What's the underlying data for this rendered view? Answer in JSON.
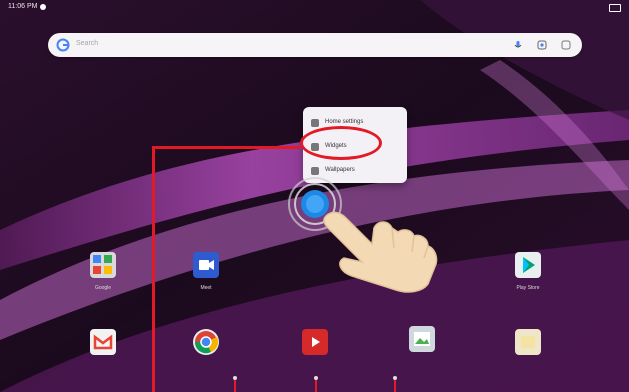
{
  "status_bar": {
    "time": "11:06 PM"
  },
  "search": {
    "placeholder": "Search"
  },
  "context_menu": {
    "items": [
      {
        "label": "Home settings"
      },
      {
        "label": "Widgets"
      },
      {
        "label": "Wallpapers"
      }
    ]
  },
  "apps": {
    "row1": [
      {
        "label": "Google",
        "icon": "google-folder-icon"
      },
      {
        "label": "Meet",
        "icon": "meet-icon"
      },
      {
        "label": "Play Store",
        "icon": "play-store-icon"
      }
    ],
    "row2": [
      {
        "label": "",
        "icon": "gmail-icon"
      },
      {
        "label": "",
        "icon": "chrome-icon"
      },
      {
        "label": "",
        "icon": "youtube-icon"
      },
      {
        "label": "",
        "icon": "photos-icon"
      },
      {
        "label": "",
        "icon": "files-icon"
      }
    ]
  },
  "colors": {
    "highlight": "#e11a25",
    "touch": "#1e88e5",
    "wallpaper_accent": "#a040a0"
  }
}
